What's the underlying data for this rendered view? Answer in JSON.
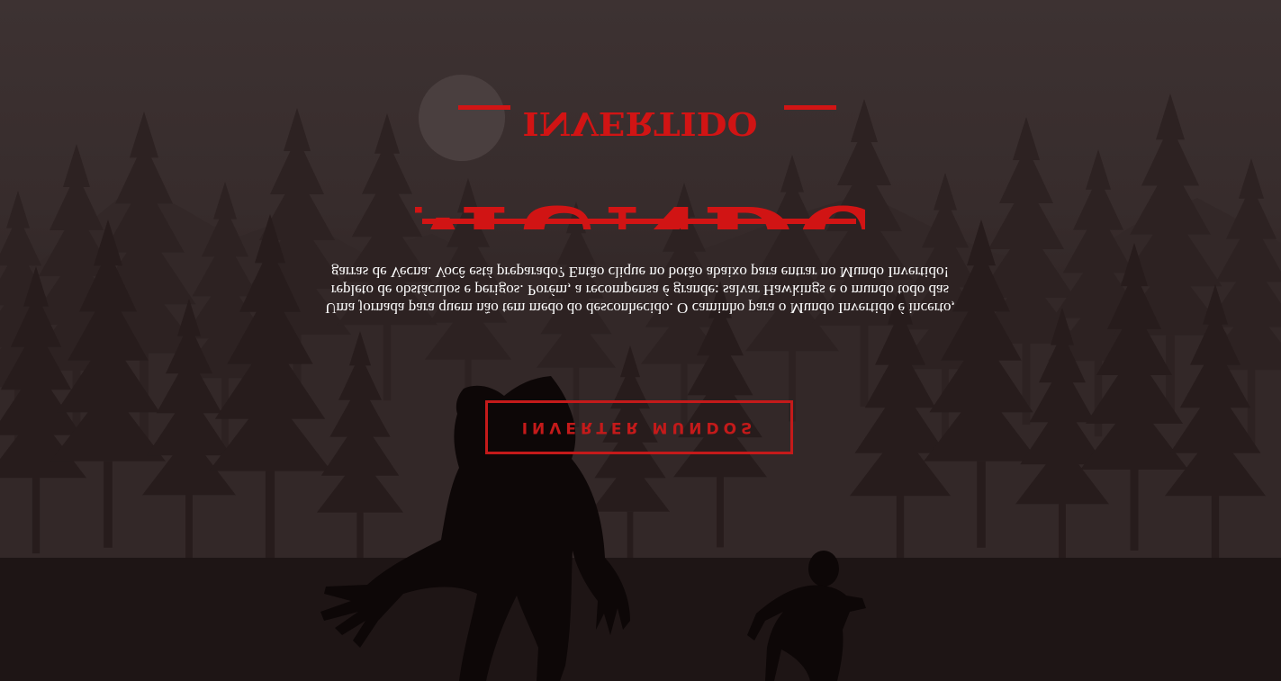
{
  "page": {
    "title_small": "INVERTIDO",
    "title_big": "MUNDO"
  },
  "intro": {
    "text": "Uma jornada para quem não tem medo do desconhecido. O caminho para o Mundo Invertido é incerto, repleto de obstáculos e perigos. Porém, a recompensa é grande: salvar Hawkings e o mundo todo das garras de Vecna. Você está preparado? Então clique no botão abaixo para entrar no Mundo Invertido!"
  },
  "actions": {
    "invert_label": "INVERTER MUNDOS"
  },
  "colors": {
    "accent": "#d11414",
    "background": "#2a1f1f",
    "text": "#ffffff"
  }
}
